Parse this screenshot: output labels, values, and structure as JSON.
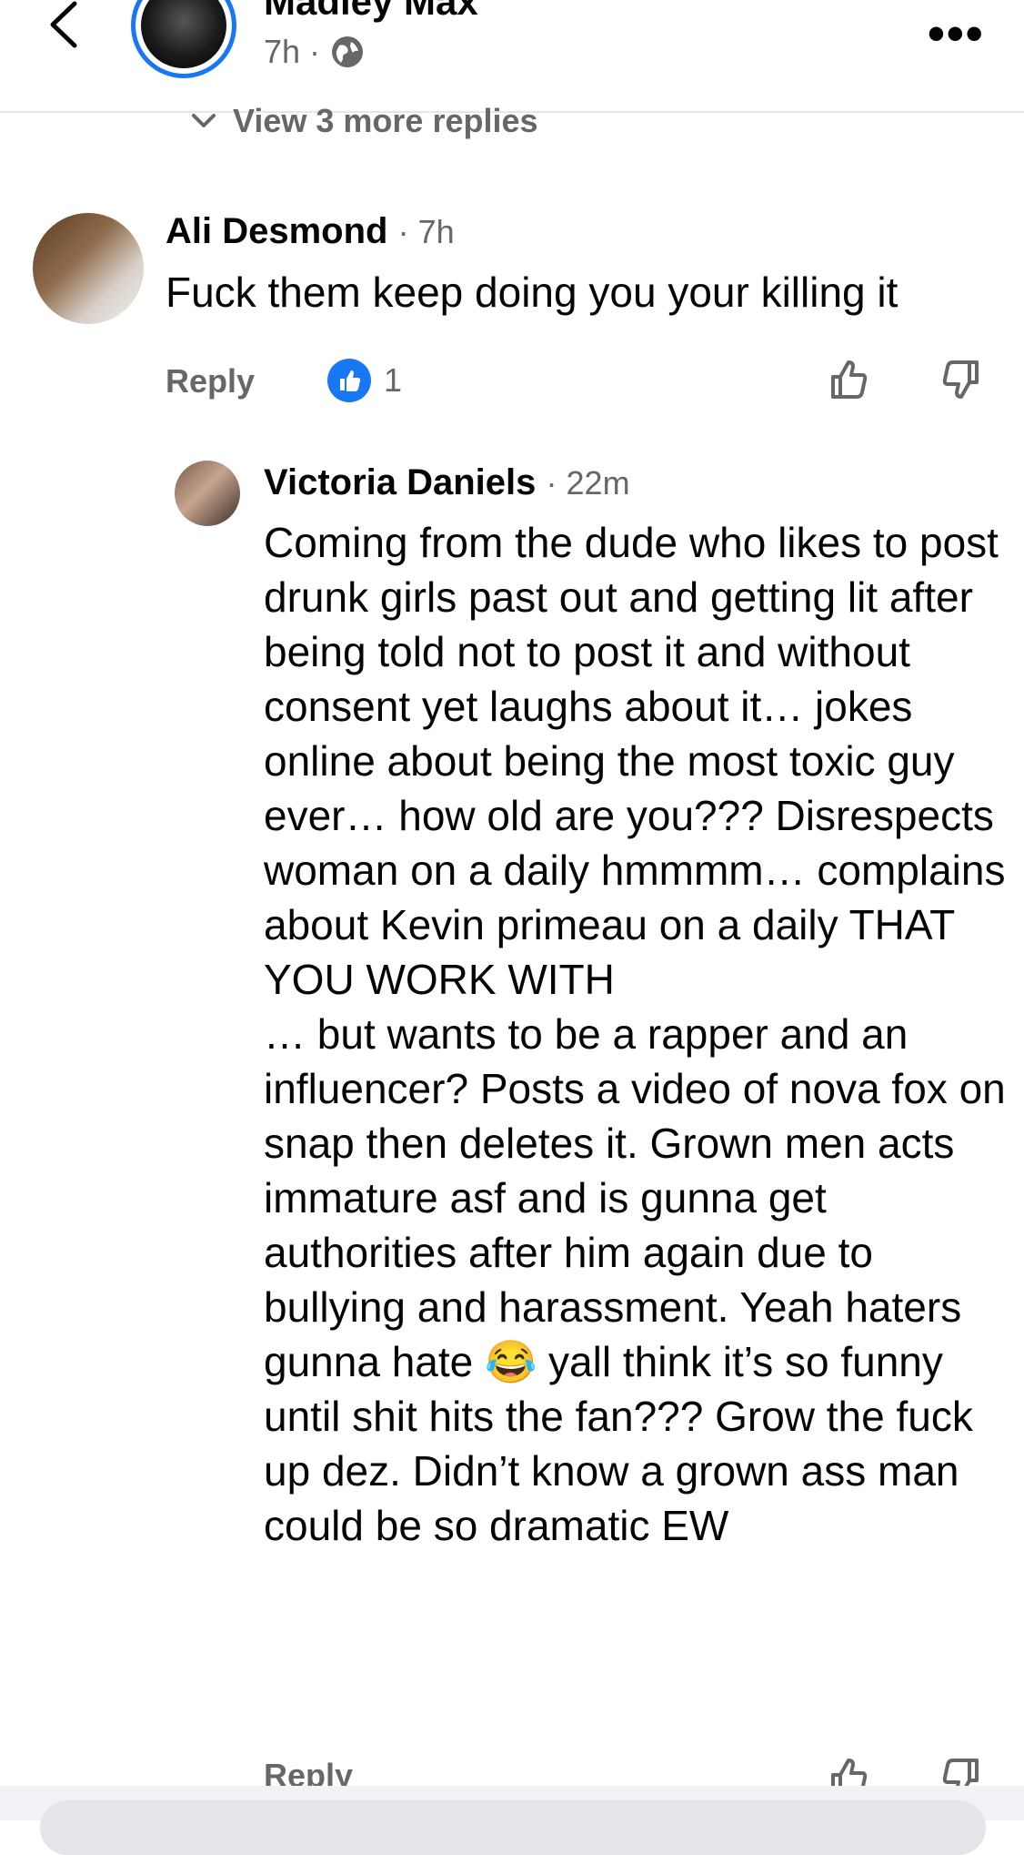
{
  "header": {
    "name": "Madley Max",
    "time": "7h",
    "dot": "·"
  },
  "replies_toggle": {
    "label": "View 3 more replies"
  },
  "comments": [
    {
      "author": "Ali Desmond",
      "time": "· 7h",
      "text": "Fuck them keep doing you your killing it",
      "reply_label": "Reply",
      "likes": "1"
    },
    {
      "author": "Victoria Daniels",
      "time": "· 22m",
      "text": "Coming from the dude who likes to post drunk girls past out and getting lit after being told not to post it and without consent yet laughs about it… jokes online about being the most toxic guy ever… how old are you??? Disrespects woman on a daily hmmmm… complains about Kevin primeau on a daily THAT YOU WORK WITH\n… but wants to be a rapper and an influencer? Posts a video of nova fox on snap then deletes it. Grown men acts immature asf and is gunna get authorities after him again due to bullying and harassment. Yeah haters gunna hate 😂 yall think it’s so funny until shit hits the fan??? Grow the fuck up dez. Didn’t know a grown ass man could be so dramatic EW",
      "reply_label": "Reply"
    }
  ],
  "icons": {
    "back": "chevron-left-icon",
    "globe": "globe-icon",
    "more": "more-options-icon",
    "like": "thumbs-up-icon",
    "dislike": "thumbs-down-icon"
  },
  "colors": {
    "accent": "#1877f2",
    "muted": "#65676b"
  }
}
